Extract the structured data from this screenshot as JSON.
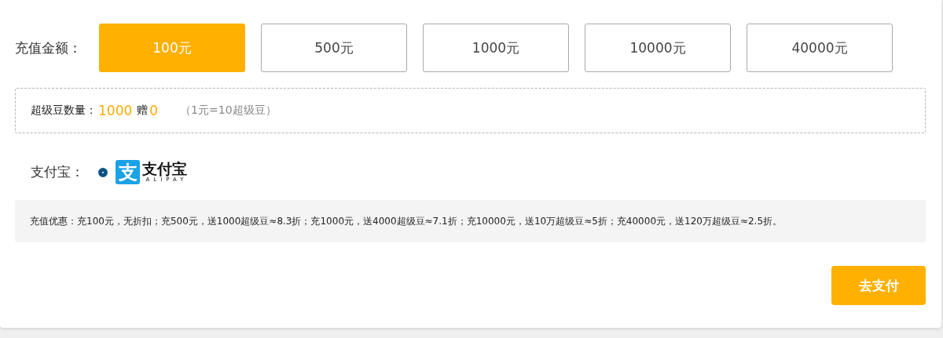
{
  "amount": {
    "label": "充值金额：",
    "options": [
      {
        "label": "100元",
        "selected": true
      },
      {
        "label": "500元",
        "selected": false
      },
      {
        "label": "1000元",
        "selected": false
      },
      {
        "label": "10000元",
        "selected": false
      },
      {
        "label": "40000元",
        "selected": false
      }
    ]
  },
  "beans": {
    "label": "超级豆数量：",
    "count": "1000",
    "bonus_label": "赠",
    "bonus": "0",
    "rate": "（1元=10超级豆）"
  },
  "payment": {
    "label": "支付宝：",
    "methods": [
      {
        "selected": true,
        "logo_mark": "支",
        "logo_name": "支付宝",
        "logo_sub": "ALIPAY"
      }
    ]
  },
  "promo": {
    "text": "充值优惠：充100元，无折扣；充500元，送1000超级豆≈8.3折；充1000元，送4000超级豆≈7.1折；充10000元，送10万超级豆≈5折；充40000元，送120万超级豆≈2.5折。"
  },
  "pay_button": "去支付"
}
